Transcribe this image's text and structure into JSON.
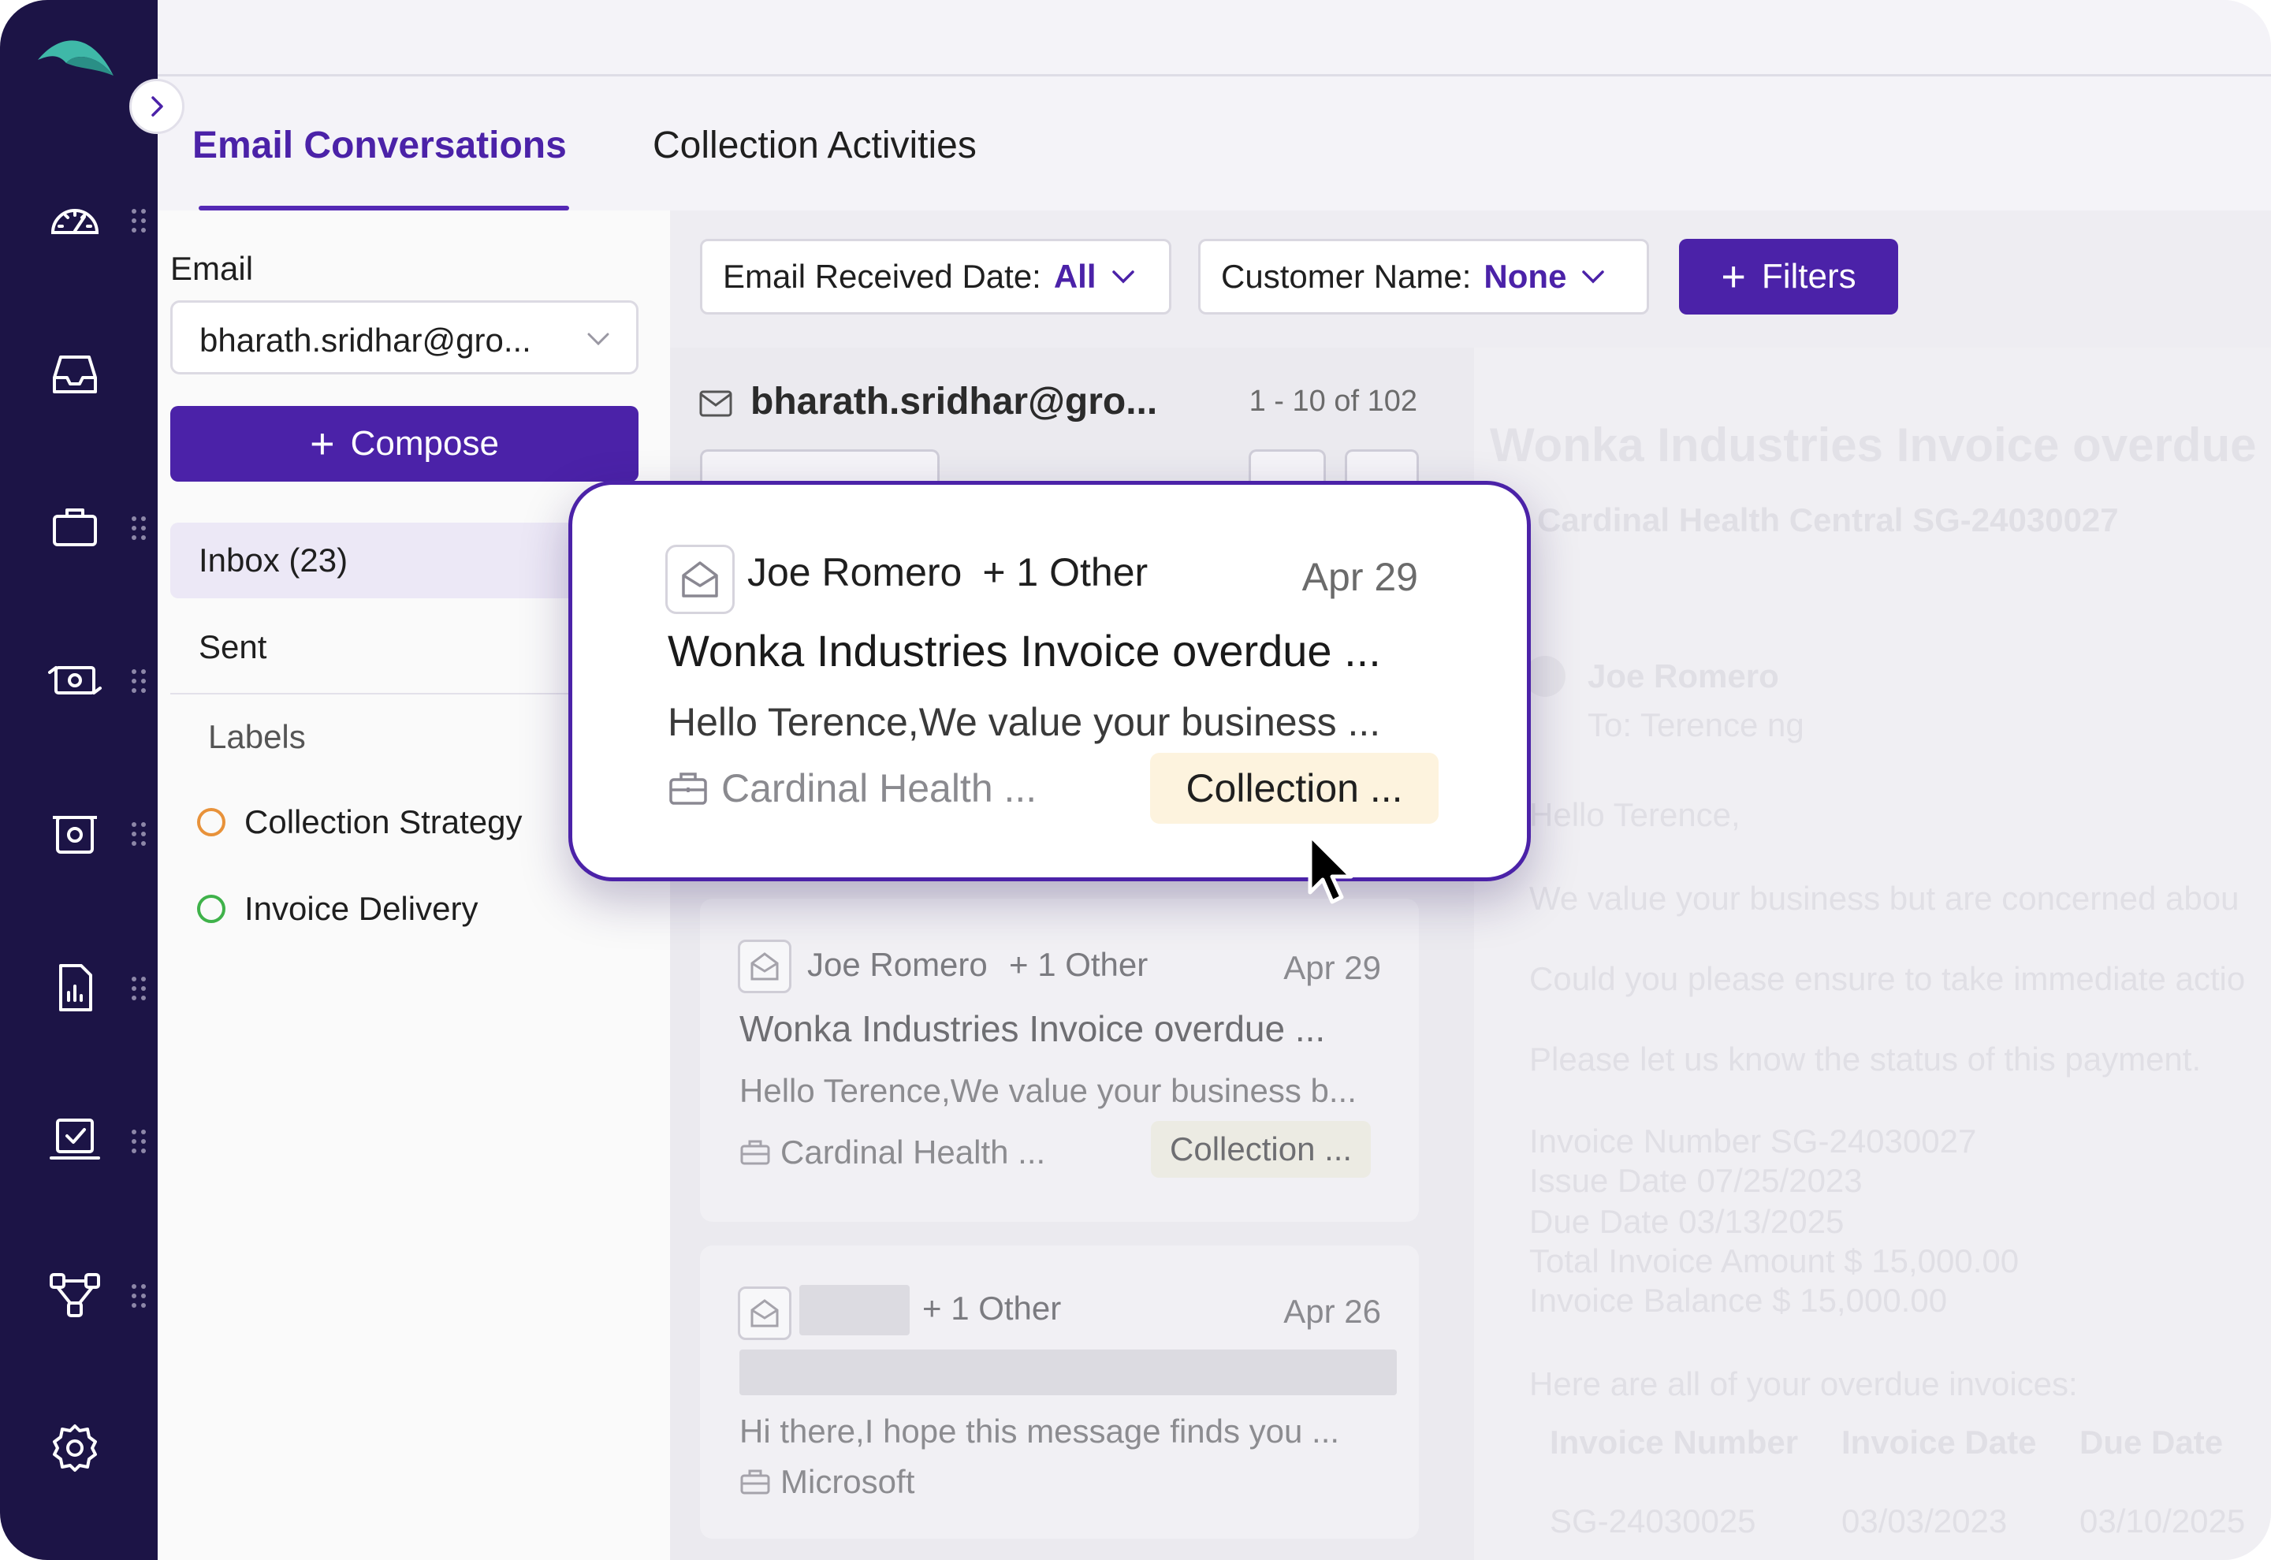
{
  "tabs": {
    "active_label": "Email Conversations",
    "second_label": "Collection Activities"
  },
  "mailbox": {
    "email_label": "Email",
    "email_value": "bharath.sridhar@gro...",
    "compose_label": "Compose",
    "folders": [
      {
        "label": "Inbox (23)"
      },
      {
        "label": "Sent"
      }
    ],
    "labels_title": "Labels",
    "labels": [
      {
        "label": "Collection Strategy",
        "color": "#e8923a"
      },
      {
        "label": "Invoice Delivery",
        "color": "#3fb24a"
      }
    ]
  },
  "filters": {
    "received_label": "Email Received Date:",
    "received_value": "All",
    "customer_label": "Customer Name:",
    "customer_value": "None",
    "filters_button": "Filters"
  },
  "list": {
    "address": "bharath.sridhar@gro...",
    "range": "1 - 10 of  102",
    "cards": [
      {
        "from": "Joe Romero",
        "others": "+ 1 Other",
        "date": "Apr 29",
        "subject": "Wonka Industries Invoice overdue ...",
        "preview": "Hello Terence,We value your business b...",
        "company": "Cardinal Health ...",
        "tag": "Collection ..."
      },
      {
        "from": "",
        "others": "+ 1 Other",
        "date": "Apr 26",
        "subject": "",
        "preview": "Hi there,I hope this message finds you ...",
        "company": "Microsoft",
        "tag": ""
      }
    ]
  },
  "popover": {
    "from": "Joe Romero",
    "others": "+ 1 Other",
    "date": "Apr 29",
    "subject": "Wonka Industries Invoice overdue ...",
    "preview": "Hello Terence,We value your business ...",
    "company": "Cardinal Health ...",
    "tag": "Collection ..."
  },
  "preview_pane": {
    "title": "Wonka Industries Invoice overdue n",
    "subtitle": "Cardinal Health Central  SG-24030027",
    "sender": "Joe Romero",
    "to": "To: Terence ng",
    "lines": [
      "Hello Terence,",
      "We value your business but are concerned abou",
      "Could you please ensure to take immediate actio",
      "Please let us know the status of this payment.",
      "Invoice Number SG-24030027",
      "Issue Date 07/25/2023",
      "Due Date 03/13/2025",
      "Total Invoice Amount $ 15,000.00",
      "Invoice Balance $ 15,000.00",
      "Here are all of your overdue invoices:"
    ],
    "table_headers": [
      "Invoice Number",
      "Invoice Date",
      "Due Date"
    ],
    "table_row": [
      "SG-24030025",
      "03/03/2023",
      "03/10/2025"
    ]
  },
  "colors": {
    "sidebar": "#1c1446",
    "accent": "#4b22a8",
    "logo": "#3fb8a8",
    "tag_bg": "#fdf3de"
  },
  "icons": {
    "sidebar": [
      "dashboard-icon",
      "inbox-icon",
      "briefcase-icon",
      "payments-icon",
      "collections-icon",
      "reports-icon",
      "tasks-icon",
      "workflow-icon",
      "settings-icon"
    ],
    "card": [
      "envelope-open-icon",
      "building-icon"
    ]
  }
}
